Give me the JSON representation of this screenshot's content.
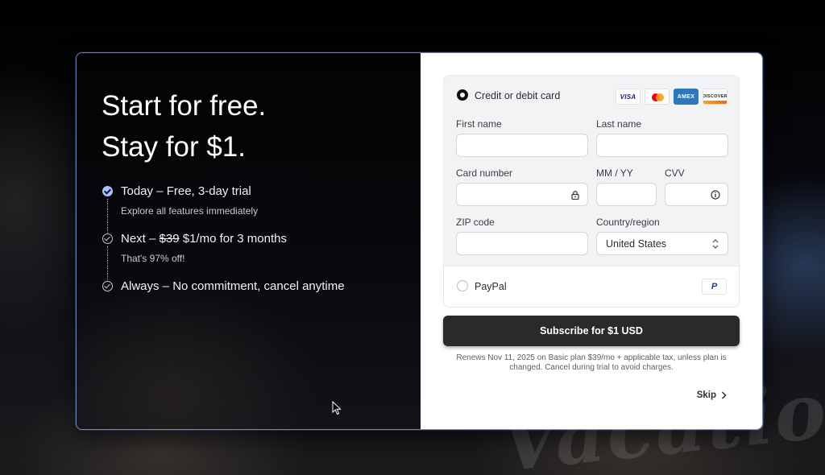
{
  "backdrop": {
    "script_text": "Vacation"
  },
  "offer": {
    "headline_line1": "Start for free.",
    "headline_line2": "Stay for $1.",
    "steps": [
      {
        "prefix": "Today – Free, 3-day trial",
        "strike": "",
        "suffix": "",
        "sub": "Explore all features immediately",
        "state": "completed"
      },
      {
        "prefix": "Next – ",
        "strike": "$39",
        "suffix": " $1/mo for 3 months",
        "sub": "That's 97% off!",
        "state": "upcoming"
      },
      {
        "prefix": "Always – No commitment, cancel anytime",
        "strike": "",
        "suffix": "",
        "sub": "",
        "state": "upcoming"
      }
    ]
  },
  "payment": {
    "card_method": {
      "label": "Credit or debit card",
      "selected": true,
      "brands": [
        "VISA",
        "Mastercard",
        "AMEX",
        "DISCOVER"
      ]
    },
    "fields": {
      "first_name": {
        "label": "First name",
        "value": ""
      },
      "last_name": {
        "label": "Last name",
        "value": ""
      },
      "card_number": {
        "label": "Card number",
        "value": ""
      },
      "expiry": {
        "label": "MM / YY",
        "value": ""
      },
      "cvv": {
        "label": "CVV",
        "value": ""
      },
      "zip": {
        "label": "ZIP code",
        "value": ""
      },
      "country": {
        "label": "Country/region",
        "value": "United States"
      }
    },
    "paypal_method": {
      "label": "PayPal",
      "selected": false,
      "badge": "P"
    }
  },
  "subscribe_label": "Subscribe for $1 USD",
  "terms": "Renews Nov 11, 2025 on Basic plan $39/mo + applicable tax, unless plan is changed. Cancel during trial to avoid charges.",
  "skip_label": "Skip",
  "colors": {
    "step_completed": "#a9c2ff",
    "button_bg": "#2a2a2c",
    "modal_border": "#96aaf0",
    "amex": "#2e77bc",
    "mastercard_red": "#eb001b",
    "mastercard_orange": "#f79e1b"
  }
}
